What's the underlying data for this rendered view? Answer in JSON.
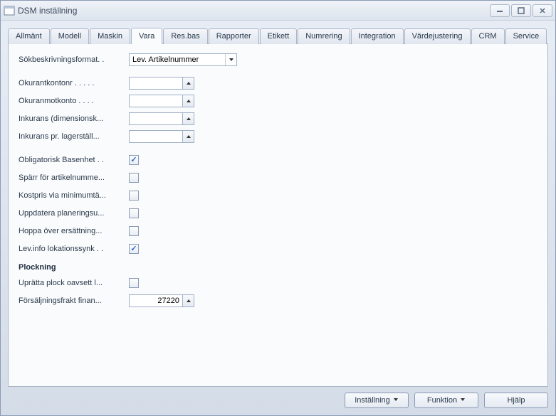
{
  "window": {
    "title": "DSM inställning"
  },
  "tabs": [
    {
      "label": "Allmänt"
    },
    {
      "label": "Modell"
    },
    {
      "label": "Maskin"
    },
    {
      "label": "Vara"
    },
    {
      "label": "Res.bas"
    },
    {
      "label": "Rapporter"
    },
    {
      "label": "Etikett"
    },
    {
      "label": "Numrering"
    },
    {
      "label": "Integration"
    },
    {
      "label": "Värdejustering"
    },
    {
      "label": "CRM"
    },
    {
      "label": "Service"
    }
  ],
  "fields": {
    "sokbeskrivning": {
      "label": "Sökbeskrivningsformat. .",
      "value": "Lev. Artikelnummer"
    },
    "okurantkontonr": {
      "label": "Okurantkontonr .  .  .  .  .",
      "value": ""
    },
    "okuranmotkonto": {
      "label": "Okuranmotkonto  .  .  .  .",
      "value": ""
    },
    "inkurans_dim": {
      "label": "Inkurans (dimensionsk...",
      "value": ""
    },
    "inkurans_lager": {
      "label": "Inkurans pr. lagerställ...",
      "value": ""
    },
    "obligatorisk_basenhet": {
      "label": "Obligatorisk Basenhet .  .",
      "checked": true
    },
    "sparr_artikelnummer": {
      "label": "Spärr för artikelnumme...",
      "checked": false
    },
    "kostpris_minimum": {
      "label": "Kostpris via minimumtä...",
      "checked": false
    },
    "uppdatera_planering": {
      "label": "Uppdatera planeringsu...",
      "checked": false
    },
    "hoppa_ersattning": {
      "label": "Hoppa över ersättning...",
      "checked": false
    },
    "levinfo_lokation": {
      "label": "Lev.info lokationssynk .  .",
      "checked": true
    },
    "section_plockning": "Plockning",
    "upratta_plock": {
      "label": "Uprätta plock oavsett l...",
      "checked": false
    },
    "forsaljningsfrakt": {
      "label": "Försäljningsfrakt finan...",
      "value": "27220"
    }
  },
  "buttons": {
    "installing": "Inställning",
    "funktion": "Funktion",
    "hjalp": "Hjälp"
  }
}
